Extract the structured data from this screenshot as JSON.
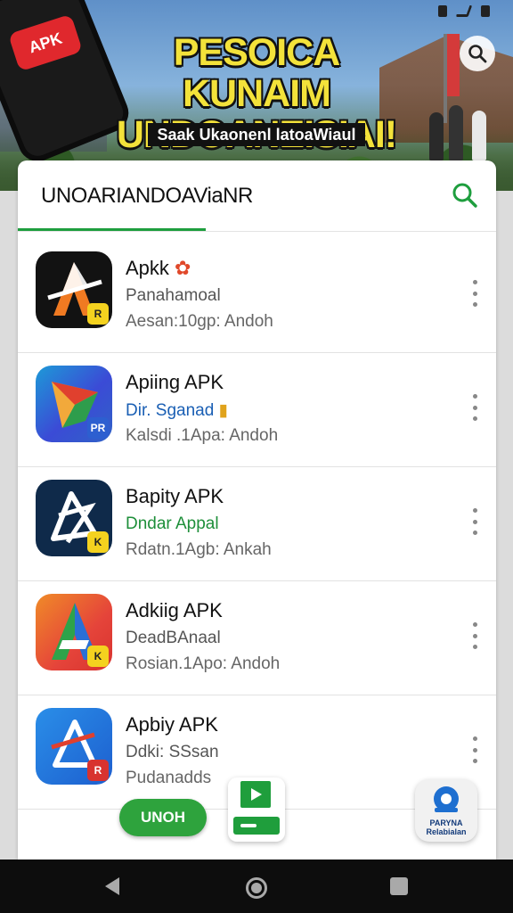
{
  "banner": {
    "badge": "APK",
    "headline": "PESOICA KUNAIM UNDOANEISIAI!",
    "subline": "Saak Ukaonenl latoaWiaul"
  },
  "search": {
    "query": "UNOARIANDOAViaNR"
  },
  "apps": [
    {
      "title": "Apkk",
      "subtitle": "Panahamoal",
      "meta": "Aesan:10gp: Andoh",
      "corner": "R",
      "subtitle_color": "#555555"
    },
    {
      "title": "Apiing APK",
      "subtitle": "Dir. Sganad",
      "meta": "Kalsdi .1Apa: Andoh",
      "corner": "PR",
      "subtitle_color": "#1a5fb4"
    },
    {
      "title": "Bapity APK",
      "subtitle": "Dndar Appal",
      "meta": "Rdatn.1Agb: Ankah",
      "corner": "K",
      "subtitle_color": "#1e8f3a"
    },
    {
      "title": "Adkiig APK",
      "subtitle": "DeadBAnaal",
      "meta": "Rosian.1Apo: Andoh",
      "corner": "K",
      "subtitle_color": "#555555"
    },
    {
      "title": "Apbiy APK",
      "subtitle": "Ddki: SSsan",
      "meta": "Pudanadds",
      "corner": "R",
      "subtitle_color": "#555555"
    }
  ],
  "buttons": {
    "green_label": "UNOH",
    "right_label": "PARYNA Relabialan"
  },
  "colors": {
    "accent_green": "#1e9e3e",
    "nav_bg": "#0d0d0d"
  }
}
